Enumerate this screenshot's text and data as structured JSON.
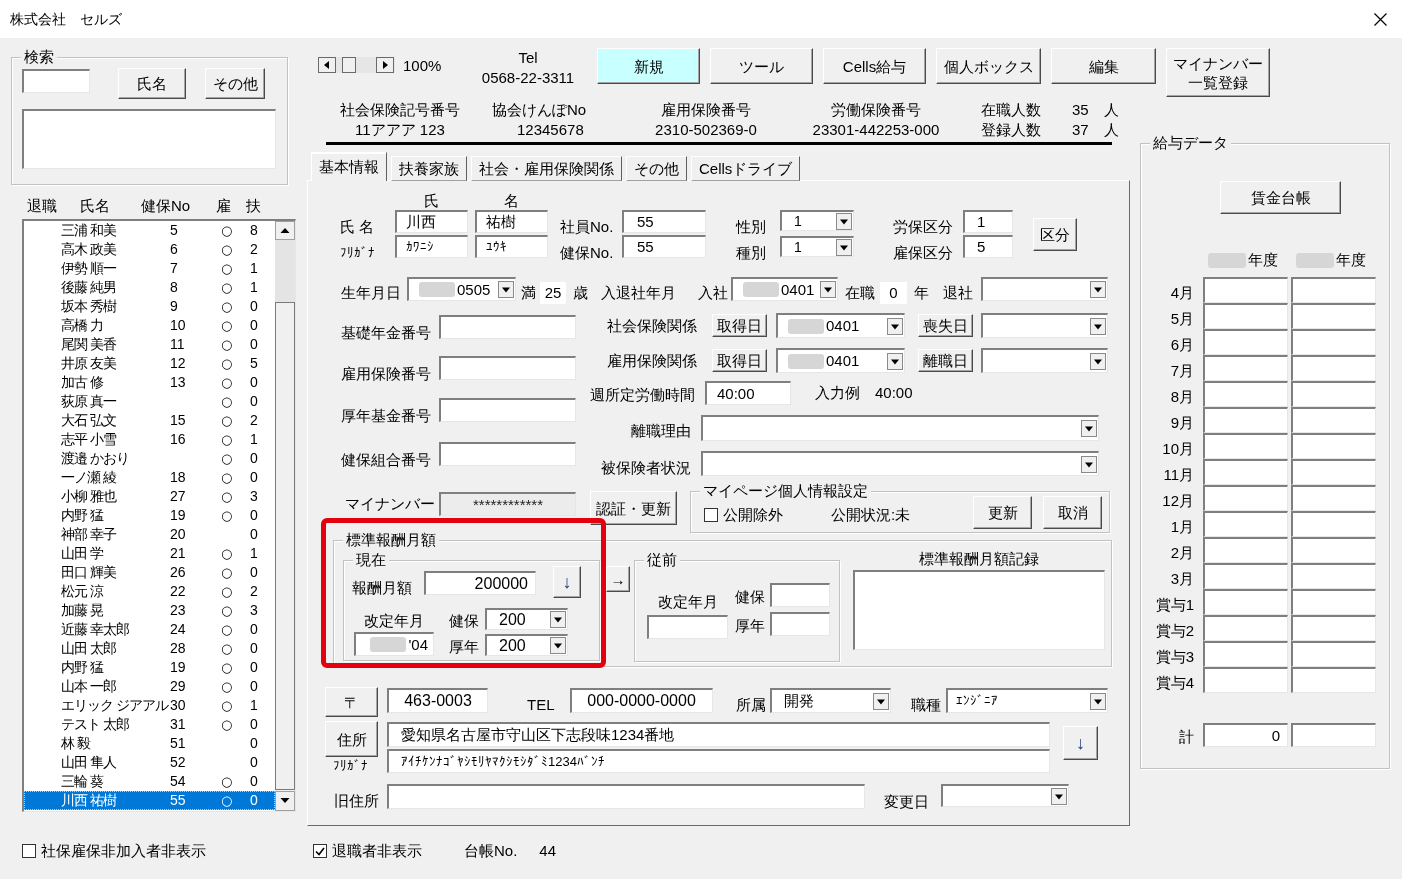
{
  "window": {
    "title": "株式会社　セルズ"
  },
  "search": {
    "legend": "検索",
    "buttons": [
      "氏名",
      "その他"
    ]
  },
  "employee_list": {
    "columns": [
      "退職",
      "氏名",
      "健保No",
      "雇",
      "扶"
    ],
    "rows": [
      {
        "name": "三浦 和美",
        "kenpo_no": "5",
        "koyo": "○",
        "fuyo": "8",
        "selected": false
      },
      {
        "name": "高木 政美",
        "kenpo_no": "6",
        "koyo": "○",
        "fuyo": "2",
        "selected": false
      },
      {
        "name": "伊勢 順一",
        "kenpo_no": "7",
        "koyo": "○",
        "fuyo": "1",
        "selected": false
      },
      {
        "name": "後藤 純男",
        "kenpo_no": "8",
        "koyo": "○",
        "fuyo": "1",
        "selected": false
      },
      {
        "name": "坂本 秀樹",
        "kenpo_no": "9",
        "koyo": "○",
        "fuyo": "0",
        "selected": false
      },
      {
        "name": "高橋 力",
        "kenpo_no": "10",
        "koyo": "○",
        "fuyo": "0",
        "selected": false
      },
      {
        "name": "尾関 美香",
        "kenpo_no": "11",
        "koyo": "○",
        "fuyo": "0",
        "selected": false
      },
      {
        "name": "井原 友美",
        "kenpo_no": "12",
        "koyo": "○",
        "fuyo": "5",
        "selected": false
      },
      {
        "name": "加古 修",
        "kenpo_no": "13",
        "koyo": "○",
        "fuyo": "0",
        "selected": false
      },
      {
        "name": "荻原 真一",
        "koyo": "○",
        "fuyo": "0",
        "selected": false
      },
      {
        "name": "大石 弘文",
        "kenpo_no": "15",
        "koyo": "○",
        "fuyo": "2",
        "selected": false
      },
      {
        "name": "志平 小雪",
        "kenpo_no": "16",
        "koyo": "○",
        "fuyo": "1",
        "selected": false
      },
      {
        "name": "渡邉 かおり",
        "koyo": "○",
        "fuyo": "0",
        "selected": false
      },
      {
        "name": "一ノ瀬 綾",
        "kenpo_no": "18",
        "koyo": "○",
        "fuyo": "0",
        "selected": false
      },
      {
        "name": "小柳 雅也",
        "kenpo_no": "27",
        "koyo": "○",
        "fuyo": "3",
        "selected": false
      },
      {
        "name": "内野 猛",
        "kenpo_no": "19",
        "koyo": "○",
        "fuyo": "0",
        "selected": false
      },
      {
        "name": "神部 幸子",
        "kenpo_no": "20",
        "fuyo": "0",
        "selected": false
      },
      {
        "name": "山田 学",
        "kenpo_no": "21",
        "koyo": "○",
        "fuyo": "1",
        "selected": false
      },
      {
        "name": "田口 輝美",
        "kenpo_no": "26",
        "koyo": "○",
        "fuyo": "0",
        "selected": false
      },
      {
        "name": "松元 涼",
        "kenpo_no": "22",
        "koyo": "○",
        "fuyo": "2",
        "selected": false
      },
      {
        "name": "加藤 晃",
        "kenpo_no": "23",
        "koyo": "○",
        "fuyo": "3",
        "selected": false
      },
      {
        "name": "近藤 幸太郎",
        "kenpo_no": "24",
        "koyo": "○",
        "fuyo": "0",
        "selected": false
      },
      {
        "name": "山田 太郎",
        "kenpo_no": "28",
        "koyo": "○",
        "fuyo": "0",
        "selected": false
      },
      {
        "name": "内野 猛",
        "kenpo_no": "19",
        "koyo": "○",
        "fuyo": "0",
        "selected": false
      },
      {
        "name": "山本 一郎",
        "kenpo_no": "29",
        "koyo": "○",
        "fuyo": "0",
        "selected": false
      },
      {
        "name": "エリック ジアアル",
        "kenpo_no": "30",
        "koyo": "○",
        "fuyo": "1",
        "selected": false
      },
      {
        "name": "テスト 太郎",
        "kenpo_no": "31",
        "koyo": "○",
        "fuyo": "0",
        "selected": false
      },
      {
        "name": "林 毅",
        "kenpo_no": "51",
        "fuyo": "0",
        "selected": false
      },
      {
        "name": "山田 隼人",
        "kenpo_no": "52",
        "fuyo": "0",
        "selected": false
      },
      {
        "name": "三輪 葵",
        "kenpo_no": "54",
        "koyo": "○",
        "fuyo": "0",
        "selected": false
      },
      {
        "name": "川西 祐樹",
        "kenpo_no": "55",
        "koyo": "○",
        "fuyo": "0",
        "selected": true
      }
    ]
  },
  "hide_uninsured": {
    "label": "社保雇保非加入者非表示",
    "checked": false
  },
  "toolbar": {
    "zoom": "100%",
    "tel_label": "Tel",
    "tel": "0568-22-3311",
    "buttons": [
      {
        "label": "新規",
        "highlighted": true
      },
      {
        "label": "ツール",
        "highlighted": false
      },
      {
        "label": "Cells給与",
        "highlighted": false
      },
      {
        "label": "個人ボックス",
        "highlighted": false
      },
      {
        "label": "編集",
        "highlighted": false
      },
      {
        "label": "マイナンバー一覧登録",
        "highlighted": false
      }
    ]
  },
  "company_info": [
    {
      "label": "社会保険記号番号",
      "value": "11アアア 123"
    },
    {
      "label": "協会けんぽNo",
      "value": "12345678"
    },
    {
      "label": "雇用保険番号",
      "value": "2310-502369-0"
    },
    {
      "label": "労働保険番号",
      "value": "23301-442253-000"
    }
  ],
  "headcount": [
    {
      "label": "在職人数",
      "value": "35",
      "unit": "人"
    },
    {
      "label": "登録人数",
      "value": "37",
      "unit": "人"
    }
  ],
  "tabs": [
    {
      "label": "基本情報",
      "selected": true
    },
    {
      "label": "扶養家族",
      "selected": false
    },
    {
      "label": "社会・雇用保険関係",
      "selected": false
    },
    {
      "label": "その他",
      "selected": false
    },
    {
      "label": "Cellsドライブ",
      "selected": false
    }
  ],
  "basic": {
    "name_headers": [
      "氏",
      "名"
    ],
    "name_rows": [
      {
        "label": "氏 名",
        "values": [
          "川西",
          "祐樹"
        ]
      },
      {
        "label": "ﾌﾘｶﾞﾅ",
        "values": [
          "ｶﾜﾆｼ",
          "ﾕｳｷ"
        ]
      }
    ],
    "numbers": [
      {
        "label": "社員No.",
        "value": "55"
      },
      {
        "label": "健保No.",
        "value": "55"
      }
    ],
    "categories": [
      {
        "label": "性別",
        "value": "1"
      },
      {
        "label": "種別",
        "value": "1"
      }
    ],
    "insurance_classes": [
      {
        "label": "労保区分",
        "value": "1"
      },
      {
        "label": "雇保区分",
        "value": "5"
      }
    ],
    "class_button": "区分",
    "birth": {
      "label": "生年月日",
      "date": "0505",
      "redacted": true,
      "age_prefix": "満",
      "age": "25",
      "age_unit": "歳"
    },
    "employment": {
      "label": "入退社年月",
      "join_label": "入社",
      "join_date": "0401",
      "redacted": true,
      "tenure_label": "在職",
      "tenure": "0",
      "tenure_unit": "年",
      "leave_label": "退社"
    },
    "numbers_left": [
      {
        "label": "基礎年金番号",
        "disabled": false
      },
      {
        "label": "雇用保険番号",
        "disabled": false
      },
      {
        "label": "厚年基金番号",
        "disabled": false
      },
      {
        "label": "健保組合番号",
        "disabled": false
      },
      {
        "label": "マイナンバー",
        "value": "************",
        "disabled": true
      }
    ],
    "insurance_relations": [
      {
        "label": "社会保険関係",
        "acquire_button": "取得日",
        "acquire_date": "0401",
        "redacted": true,
        "loss_button": "喪失日"
      },
      {
        "label": "雇用保険関係",
        "acquire_button": "取得日",
        "acquire_date": "0401",
        "redacted": true,
        "loss_button": "離職日"
      }
    ],
    "weekly_hours": {
      "label": "週所定労働時間",
      "value": "40:00",
      "example_label": "入力例",
      "example": "40:00"
    },
    "dropdowns": [
      {
        "label": "離職理由"
      },
      {
        "label": "被保険者状況"
      }
    ],
    "mynumber_button": "認証・更新",
    "mypage": {
      "legend": "マイページ個人情報設定",
      "exclude": {
        "label": "公開除外",
        "checked": false
      },
      "status": "公開状況:未",
      "buttons": [
        "更新",
        "取消"
      ]
    },
    "standard_remuneration": {
      "legend": "標準報酬月額",
      "highlighted": true,
      "current": {
        "legend": "現在",
        "amount_label": "報酬月額",
        "amount": "200000",
        "down_button": "↓",
        "revision_label": "改定年月",
        "revision": "'04",
        "revision_redacted": true,
        "grades": [
          {
            "label": "健保",
            "value": "200"
          },
          {
            "label": "厚年",
            "value": "200"
          }
        ]
      },
      "copy_button": "→",
      "previous": {
        "legend": "従前",
        "revision_label": "改定年月",
        "grades": [
          {
            "label": "健保"
          },
          {
            "label": "厚年"
          }
        ]
      },
      "record_label": "標準報酬月額記録"
    },
    "contact": {
      "postal_button": "〒",
      "postal": "463-0003",
      "tel_label": "TEL",
      "tel": "000-0000-0000",
      "department_label": "所属",
      "department": "開発",
      "job_label": "職種",
      "job": "ｴﾝｼﾞﾆｱ"
    },
    "address": {
      "button": "住所",
      "value": "愛知県名古屋市守山区下志段味1234番地",
      "kana_label": "ﾌﾘｶﾞﾅ",
      "kana": "ｱｲﾁｹﾝﾅｺﾞﾔｼﾓﾘﾔﾏｸｼﾓｼﾀﾞﾐ1234ﾊﾞﾝﾁ",
      "down_button": "↓"
    },
    "old_address": {
      "label": "旧住所",
      "change_date_label": "変更日"
    }
  },
  "footer": {
    "hide_retired": {
      "label": "退職者非表示",
      "checked": true
    },
    "ledger_label": "台帳No.",
    "ledger_no": "44"
  },
  "salary_data": {
    "legend": "給与データ",
    "ledger_button": "賃金台帳",
    "year_headers": [
      {
        "label": "年度",
        "redacted": true
      },
      {
        "label": "年度",
        "redacted": true
      }
    ],
    "rows": [
      {
        "label": "4月"
      },
      {
        "label": "5月"
      },
      {
        "label": "6月"
      },
      {
        "label": "7月"
      },
      {
        "label": "8月"
      },
      {
        "label": "9月"
      },
      {
        "label": "10月"
      },
      {
        "label": "11月"
      },
      {
        "label": "12月"
      },
      {
        "label": "1月"
      },
      {
        "label": "2月"
      },
      {
        "label": "3月"
      },
      {
        "label": "賞与1"
      },
      {
        "label": "賞与2"
      },
      {
        "label": "賞与3"
      },
      {
        "label": "賞与4"
      }
    ],
    "total": {
      "label": "計",
      "value": "0"
    }
  }
}
